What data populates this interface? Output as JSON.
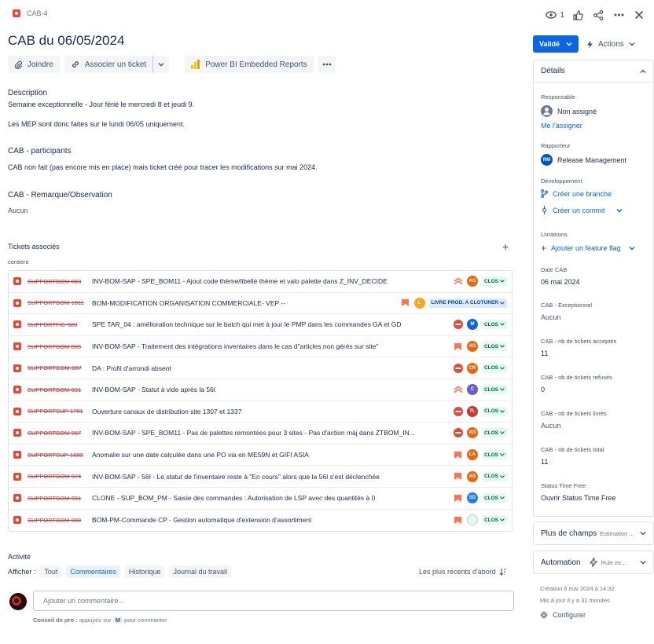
{
  "issue": {
    "key": "CAB-4",
    "title": "CAB du 06/05/2024",
    "watchers": "1"
  },
  "toolbar": {
    "attach": "Joindre",
    "link": "Associer un ticket",
    "powerbi": "Power BI Embedded Reports"
  },
  "description": {
    "label": "Description",
    "line1": "Semaine exceptionnelle - Jour férié le mercredi 8 et jeudi 9.",
    "line2": "Les MEP sont donc faites sur le lundi 06/05 uniquement."
  },
  "participants": {
    "label": "CAB - participants",
    "text": "CAB non fait (pas encore mis en place) mais ticket créé pour tracer les modifications sur mai 2024."
  },
  "remarque": {
    "label": "CAB - Remarque/Observation",
    "value": "Aucun"
  },
  "linked": {
    "label": "Tickets associés",
    "relation": "contient",
    "rows": [
      {
        "key": "SUPPORTBOM-863",
        "summary": "INV-BOM-SAP - SPE_BOM11 - Ajout code thème/libellé thème et valo palette dans Z_INV_DECIDE",
        "priority": "lowest",
        "avatar": "AG",
        "avatar_color": "#e56910",
        "status": "CLOS"
      },
      {
        "key": "SUPPORTBOM-1011",
        "summary": "BOM-MODIFICATION ORGANISATION COMMERCIALE- VEP --",
        "priority": "high",
        "avatar": "L",
        "avatar_color": "#f5a623",
        "status": "LIVRE PROD. A CLOTURER"
      },
      {
        "key": "SUPPORTFIC-589",
        "summary": "SPE TAR_04 : amélioration technique sur le batch qui met à jour le PMP dans les commandes GA et GD",
        "priority": "blocker",
        "avatar": "M",
        "avatar_color": "#0c66e4",
        "status": "CLOS"
      },
      {
        "key": "SUPPORTBOM-865",
        "summary": "INV-BOM-SAP - Traitement des intégrations inventaires dans le cas d\"articles non gérés sur site\"",
        "priority": "high",
        "avatar": "AG",
        "avatar_color": "#e56910",
        "status": "CLOS"
      },
      {
        "key": "SUPPORTCOM-887",
        "summary": "DA : Profil d'arrondi absent",
        "priority": "blocker",
        "avatar": "CR",
        "avatar_color": "#e56910",
        "status": "CLOS"
      },
      {
        "key": "SUPPORTBOM-831",
        "summary": "INV-BOM-SAP - Statut à vide après la 56I",
        "priority": "lowest",
        "avatar": "C",
        "avatar_color": "#6e5dc6",
        "status": "CLOS"
      },
      {
        "key": "SUPPORTSUP-1701",
        "summary": "Ouverture canaux de distribution site 1307 et 1337",
        "priority": "blocker",
        "avatar": "TL",
        "avatar_color": "#c9372c",
        "status": "CLOS"
      },
      {
        "key": "SUPPORTBOM-967",
        "summary": "INV-BOM-SAP - SPE_BOM11 - Pas de palettes remontées pour 3 sites - Pas d'action màj dans ZTBOM_IN...",
        "priority": "blocker",
        "avatar": "AG",
        "avatar_color": "#e56910",
        "status": "CLOS"
      },
      {
        "key": "SUPPORTSUP-1683",
        "summary": "Anomalie sur une date calculée dans une PO via en ME59N et GIFI ASIA",
        "priority": "high",
        "avatar": "LA",
        "avatar_color": "#e56910",
        "status": "CLOS"
      },
      {
        "key": "SUPPORTBOM-974",
        "summary": "INV-BOM-SAP - 56I - Le statut de l'inventaire reste à \"En cours\" alors que la 56I s'est déclenchée",
        "priority": "high",
        "avatar": "AG",
        "avatar_color": "#e56910",
        "status": "CLOS"
      },
      {
        "key": "SUPPORTBOM-991",
        "summary": "CLONE - SUP_BOM_PM - Saisie des commandes : Autorisation de LSP avec des quantités à 0",
        "priority": "high",
        "avatar": "SD",
        "avatar_color": "#1d7afc",
        "status": "CLOS"
      },
      {
        "key": "SUPPORTBOM-900",
        "summary": "BOM-PM-Commande CP - Gestion automatique d'extension d'assortiment",
        "priority": "high",
        "avatar": "",
        "avatar_color": "#e6f7ed",
        "status": "CLOS"
      }
    ]
  },
  "activity": {
    "label": "Activité",
    "show": "Afficher :",
    "filters": [
      "Tout",
      "Commentaires",
      "Historique",
      "Journal du travail"
    ],
    "sort": "Les plus récents d'abord",
    "comment_placeholder": "Ajouter un commentaire...",
    "tip_prefix": "Conseil de pro :",
    "tip_text": "appuyez sur",
    "tip_key": "M",
    "tip_suffix": "pour commenter"
  },
  "sidebar": {
    "status_button": "Validé",
    "actions": "Actions",
    "details": "Détails",
    "assignee_label": "Responsable",
    "assignee_value": "Non assigné",
    "assign_me": "Me l'assigner",
    "reporter_label": "Rapporteur",
    "reporter_initials": "RM",
    "reporter_value": "Release Management",
    "dev_label": "Développement",
    "create_branch": "Créer une branche",
    "create_commit": "Créer un commit",
    "releases_label": "Livraisons",
    "feature_flag": "Ajouter un feature flag",
    "date_label": "Date CAB",
    "date_value": "06 mai 2024",
    "exc_label": "CAB - Exceptionnel",
    "exc_value": "Aucun",
    "accepted_label": "CAB - nb de tickets acceptés",
    "accepted_value": "11",
    "refused_label": "CAB - nb de tickets refusés",
    "refused_value": "0",
    "delivered_label": "CAB - nb de tickets livrés",
    "delivered_value": "Aucun",
    "total_label": "CAB - nb de tickets total",
    "total_value": "11",
    "stf_label": "Status Time Free",
    "stf_value": "Ouvrir Status Time Free",
    "more_fields": "Plus de champs",
    "more_fields_sub": "Estimation ...",
    "automation": "Automation",
    "automation_sub": "Rule ex...",
    "created": "Création 6 mai 2024 à 14:32",
    "updated": "Mis à jour il y a 31 minutes",
    "configure": "Configurer"
  }
}
